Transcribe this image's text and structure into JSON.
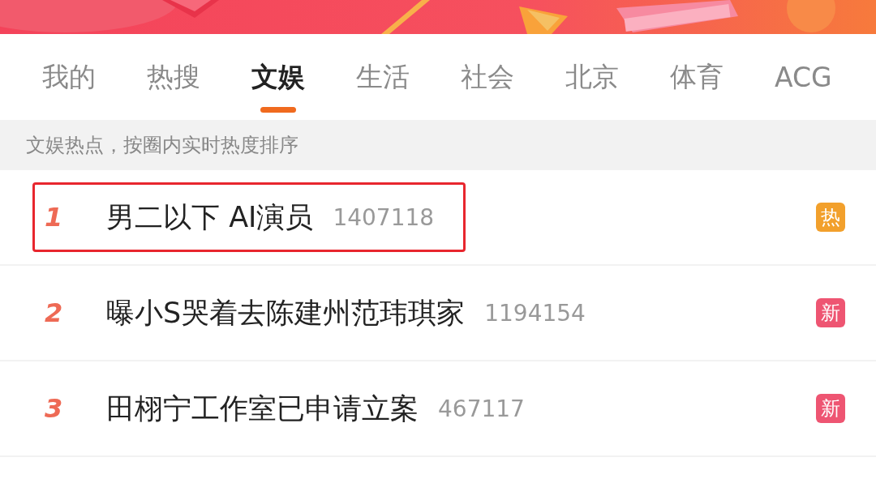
{
  "tabs": [
    {
      "label": "我的",
      "selected": false
    },
    {
      "label": "热搜",
      "selected": false
    },
    {
      "label": "文娱",
      "selected": true
    },
    {
      "label": "生活",
      "selected": false
    },
    {
      "label": "社会",
      "selected": false
    },
    {
      "label": "北京",
      "selected": false
    },
    {
      "label": "体育",
      "selected": false
    },
    {
      "label": "ACG",
      "selected": false
    }
  ],
  "subtitle": "文娱热点，按圈内实时热度排序",
  "rows": [
    {
      "rank": "1",
      "title": "男二以下 AI演员",
      "count": "1407118",
      "badge": "热",
      "color": "#f2a02c",
      "highlighted": true
    },
    {
      "rank": "2",
      "title": "曝小S哭着去陈建州范玮琪家",
      "count": "1194154",
      "badge": "新",
      "color": "#ee5572",
      "highlighted": false
    },
    {
      "rank": "3",
      "title": "田栩宁工作室已申请立案",
      "count": "467117",
      "badge": "新",
      "color": "#ee5572",
      "highlighted": false
    }
  ]
}
